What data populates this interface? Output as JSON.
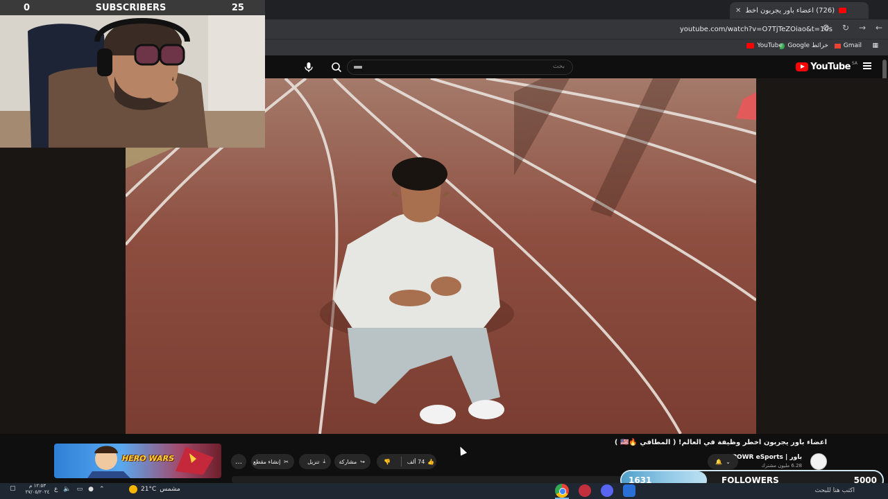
{
  "browser": {
    "tab_title": "(726) اعضاء باور يجربون اخط",
    "new_tab": "+",
    "close_tab": "✕",
    "url": "youtube.com/watch?v=O7TjTeZOiao&t=10s",
    "bookmarks": [
      {
        "label": "YouTube"
      },
      {
        "label": "Google خرائط"
      },
      {
        "label": "Gmail"
      }
    ]
  },
  "youtube": {
    "logo_text": "YouTube",
    "region": "SA",
    "search_placeholder": "بحث",
    "video_title": "اعضاء باور يجربون اخطر وظيفة في العالم! ( المطافي 🔥🇺🇸 )",
    "channel_name": "باور | POWR eSports",
    "channel_subs": "6.28 مليون مشترك",
    "like_count": "74 ألف",
    "share_label": "مشاركة",
    "download_label": "تنزيل",
    "clip_label": "إنشاء مقطع",
    "more_label": "…"
  },
  "stream_overlay": {
    "subscribers_label": "SUBSCRIBERS",
    "subscribers_current": "0",
    "subscribers_goal": "25",
    "followers_label": "FOLLOWERS",
    "followers_current": "1631",
    "followers_goal": "5000",
    "followers_progress": 0.3262,
    "ad_title": "HERO WARS"
  },
  "taskbar": {
    "time": "١٢:٥٣ م",
    "date": "٢٧/٠٥/٢٠٢٤",
    "temperature": "21°C",
    "weather_label": "مشمس",
    "search_placeholder": "اكتب هنا للبحث"
  },
  "colors": {
    "youtube_red": "#ff0000",
    "followers_fill": "#8ec7e5",
    "track": "#8a4a3c"
  }
}
